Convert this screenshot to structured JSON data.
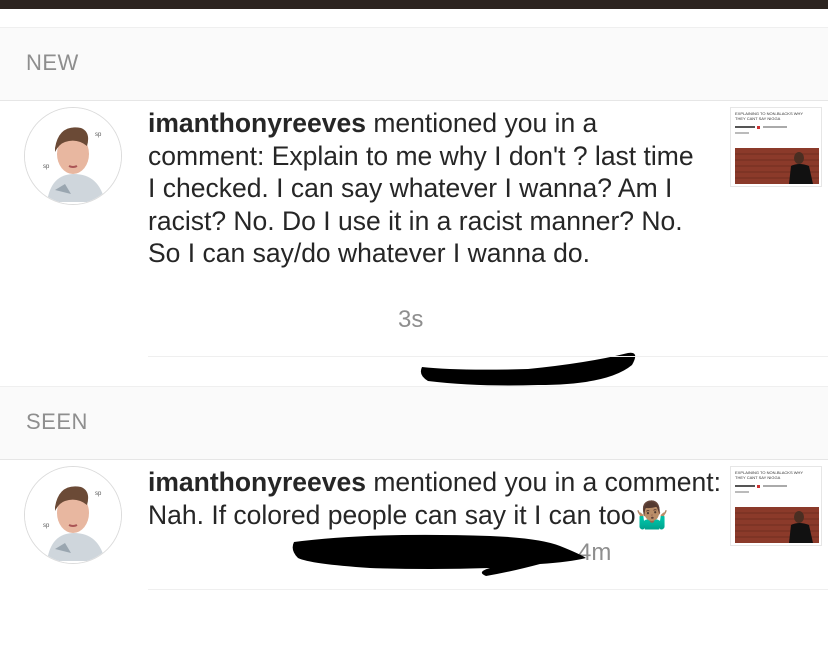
{
  "sections": [
    {
      "header": "NEW",
      "notification": {
        "username": "imanthonyreeves",
        "text": " mentioned you in a comment: Explain to me why I don't ? last time I checked. I can say whatever I wanna? Am I racist? No. Do I use it in a racist manner? No. So I can say/do whatever I wanna do.",
        "time": "3s"
      }
    },
    {
      "header": "SEEN",
      "notification": {
        "username": "imanthonyreeves",
        "text": " mentioned you in a comment: Nah. If colored people can say it I can too",
        "emoji": "🤷🏽‍♂️",
        "time": "4m"
      }
    }
  ],
  "thumbnail": {
    "caption_line1": "EXPLAINING TO NON-BLACKS WHY",
    "caption_line2": "THEY CANT SAY NIGGA"
  },
  "colors": {
    "secondary_text": "#8e8e8e",
    "primary_text": "#262626",
    "header_bg": "#fafafa",
    "redaction": "#000000"
  }
}
